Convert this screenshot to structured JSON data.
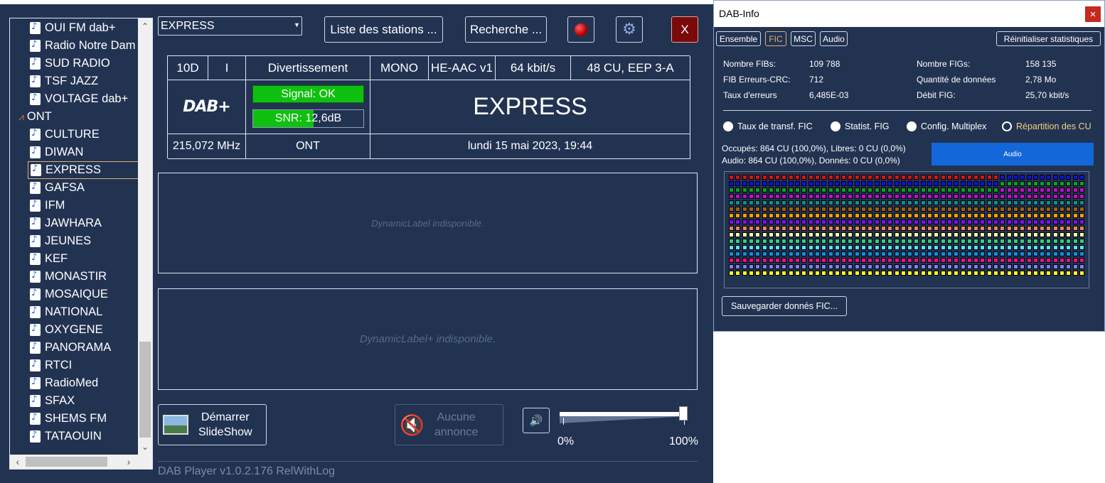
{
  "tree": {
    "items": [
      {
        "label": "OUI FM dab+",
        "type": "station"
      },
      {
        "label": "Radio Notre Dam",
        "type": "station"
      },
      {
        "label": "SUD RADIO",
        "type": "station"
      },
      {
        "label": "TSF JAZZ",
        "type": "station"
      },
      {
        "label": "VOLTAGE dab+",
        "type": "station"
      },
      {
        "label": "ONT",
        "type": "ensemble"
      },
      {
        "label": "CULTURE",
        "type": "station"
      },
      {
        "label": "DIWAN",
        "type": "station"
      },
      {
        "label": "EXPRESS",
        "type": "station",
        "selected": true
      },
      {
        "label": "GAFSA",
        "type": "station"
      },
      {
        "label": "IFM",
        "type": "station"
      },
      {
        "label": "JAWHARA",
        "type": "station"
      },
      {
        "label": "JEUNES",
        "type": "station"
      },
      {
        "label": "KEF",
        "type": "station"
      },
      {
        "label": "MONASTIR",
        "type": "station"
      },
      {
        "label": "MOSAIQUE",
        "type": "station"
      },
      {
        "label": "NATIONAL",
        "type": "station"
      },
      {
        "label": "OXYGENE",
        "type": "station"
      },
      {
        "label": "PANORAMA",
        "type": "station"
      },
      {
        "label": "RTCI",
        "type": "station"
      },
      {
        "label": "RadioMed",
        "type": "station"
      },
      {
        "label": "SFAX",
        "type": "station"
      },
      {
        "label": "SHEMS FM",
        "type": "station"
      },
      {
        "label": "TATAOUIN",
        "type": "station"
      }
    ]
  },
  "toolbar": {
    "station_select": "EXPRESS",
    "station_list_label": "Liste des stations ...",
    "search_label": "Recherche ...",
    "close_label": "X",
    "record_icon": "record-icon",
    "settings_icon": "gear-icon"
  },
  "info_table": {
    "channel": "10D",
    "language_code": "I",
    "genre": "Divertissement",
    "mode": "MONO",
    "codec": "HE-AAC v1",
    "bitrate": "64 kbit/s",
    "protection": "48 CU, EEP 3-A",
    "logo": "DAB+",
    "signal": "Signal: OK",
    "snr": "SNR: 12,6dB",
    "snr_level": 0.55,
    "station_name": "EXPRESS",
    "frequency": "215,072 MHz",
    "ensemble": "ONT",
    "datetime": "lundi 15 mai 2023, 19:44"
  },
  "dynamic_label": "DynamicLabel indisponible.",
  "dynamic_label_plus": "DynamicLabel+ indisponible.",
  "slideshow": {
    "line1": "Démarrer",
    "line2": "SlideShow"
  },
  "announcement": {
    "line1": "Aucune",
    "line2": "annonce"
  },
  "volume": {
    "min_label": "0%",
    "max_label": "100%",
    "level": 1.0
  },
  "footer": "DAB Player v1.0.2.176 RelWithLog",
  "dab_info": {
    "title": "DAB-Info",
    "close": "×",
    "tabs": [
      "Ensemble",
      "FIC",
      "MSC",
      "Audio"
    ],
    "active_tab": "FIC",
    "reset_label": "Réinitialiser statistiques",
    "stats": {
      "fibs_label": "Nombre FIBs:",
      "fibs_value": "109 788",
      "crc_label": "FIB Erreurs-CRC:",
      "crc_value": "712",
      "err_label": "Taux d'erreurs",
      "err_value": "6,485E-03",
      "figs_label": "Nombre FIGs:",
      "figs_value": "158 135",
      "data_label": "Quantité de données",
      "data_value": "2,78 Mo",
      "rate_label": "Débit FIG:",
      "rate_value": "25,70 kbit/s"
    },
    "radios": [
      "Taux de transf. FIC",
      "Statist. FIG",
      "Config. Multiplex",
      "Répartition des CU"
    ],
    "selected_radio": 3,
    "occupancy_line1": "Occupés: 864 CU (100,0%), Libres: 0 CU (0,0%)",
    "occupancy_line2": "Audio: 864 CU (100,0%), Donnés: 0 CU (0,0%)",
    "audio_badge": "Audio",
    "save_label": "Sauvegarder donnés FIC..."
  },
  "colors": {
    "bg": "#223352",
    "accent_blue": "#1467d9",
    "signal_green": "#10c010",
    "close_red": "#7a0a0a",
    "cu_palette": [
      "#e01010",
      "#1010e0",
      "#10a020",
      "#c010c0",
      "#109090",
      "#a06010",
      "#ffa000",
      "#8010f0",
      "#f08060",
      "#ffffa0",
      "#30d080",
      "#60e0f0",
      "#1090e0",
      "#f01080",
      "#8080f0",
      "#ffff20",
      "#a0a0f0",
      "#000000"
    ]
  }
}
